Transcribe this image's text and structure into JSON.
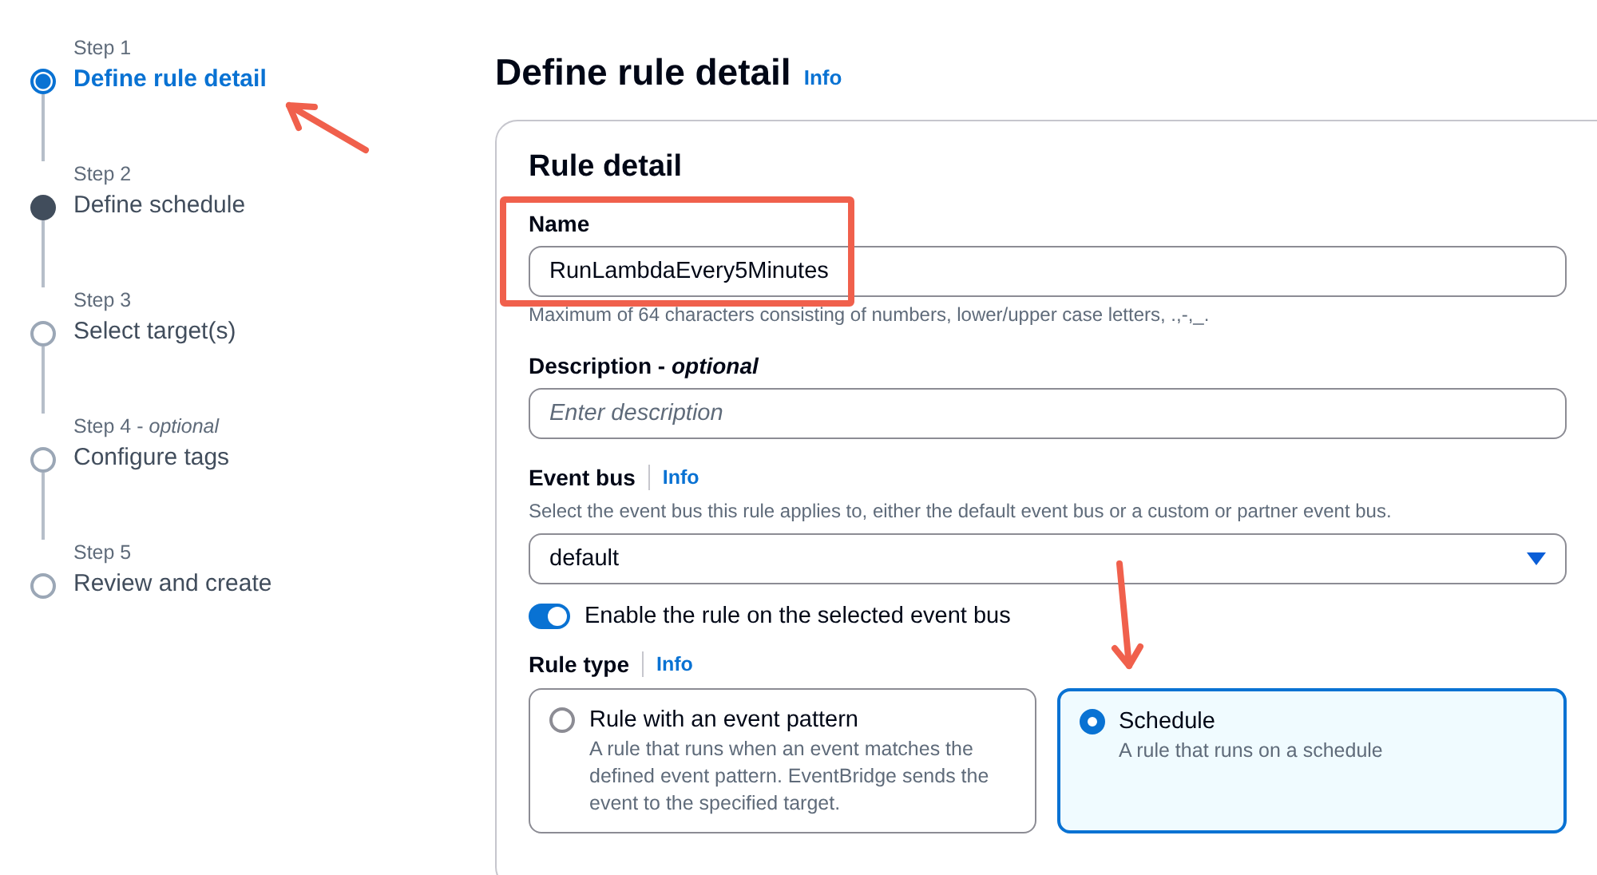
{
  "steps": [
    {
      "step": "Step 1",
      "title": "Define rule detail",
      "kind": "current"
    },
    {
      "step": "Step 2",
      "title": "Define schedule",
      "kind": "next"
    },
    {
      "step": "Step 3",
      "title": "Select target(s)",
      "kind": "upcoming"
    },
    {
      "step": "Step 4 - *optional*",
      "title": "Configure tags",
      "kind": "upcoming"
    },
    {
      "step": "Step 5",
      "title": "Review and create",
      "kind": "upcoming"
    }
  ],
  "page": {
    "title": "Define rule detail",
    "info": "Info"
  },
  "card": {
    "title": "Rule detail",
    "name": {
      "label": "Name",
      "value": "RunLambdaEvery5Minutes",
      "hint": "Maximum of 64 characters consisting of numbers, lower/upper case letters, .,-,_."
    },
    "description": {
      "label": "Description - *optional*",
      "placeholder": "Enter description"
    },
    "event_bus": {
      "label": "Event bus",
      "info": "Info",
      "hint": "Select the event bus this rule applies to, either the default event bus or a custom or partner event bus.",
      "value": "default"
    },
    "enable_toggle": {
      "label": "Enable the rule on the selected event bus",
      "on": true
    },
    "rule_type": {
      "label": "Rule type",
      "info": "Info",
      "options": [
        {
          "title": "Rule with an event pattern",
          "description": "A rule that runs when an event matches the defined event pattern. EventBridge sends the event to the specified target.",
          "selected": false
        },
        {
          "title": "Schedule",
          "description": "A rule that runs on a schedule",
          "selected": true
        }
      ]
    }
  }
}
